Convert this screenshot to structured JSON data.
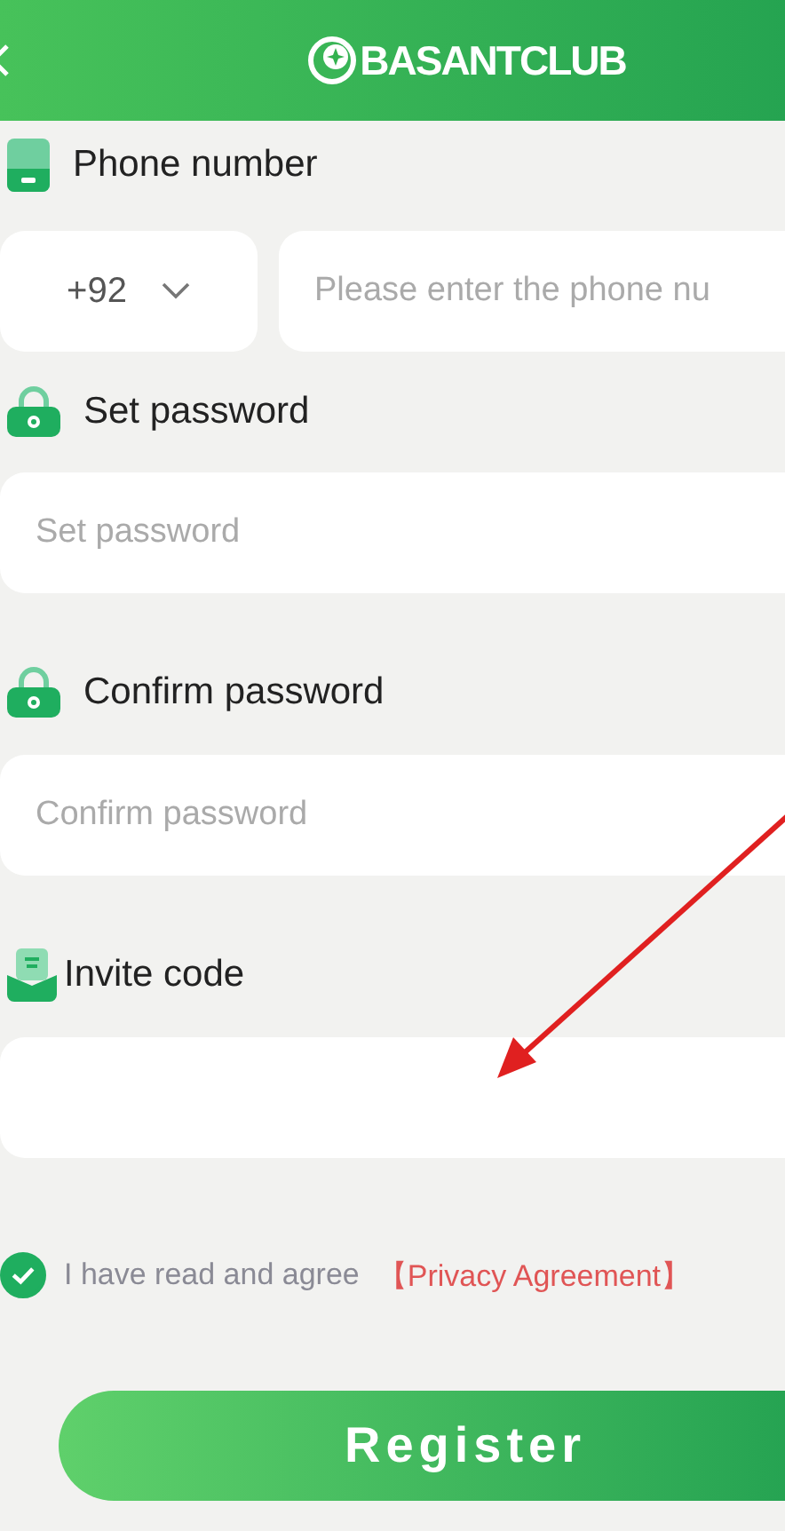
{
  "header": {
    "logo_text": "BASANTCLUB"
  },
  "fields": [
    {
      "kind": "phone",
      "label": "Phone number",
      "country_code": "+92",
      "placeholder": "Please enter the phone nu"
    },
    {
      "kind": "password",
      "label": "Set password",
      "placeholder": "Set password"
    },
    {
      "kind": "password",
      "label": "Confirm password",
      "placeholder": "Confirm password"
    },
    {
      "kind": "invite",
      "label": "Invite code"
    }
  ],
  "agreement": {
    "checked": true,
    "text": "I have read and agree",
    "link": "【Privacy Agreement】"
  },
  "register_button": "Register"
}
